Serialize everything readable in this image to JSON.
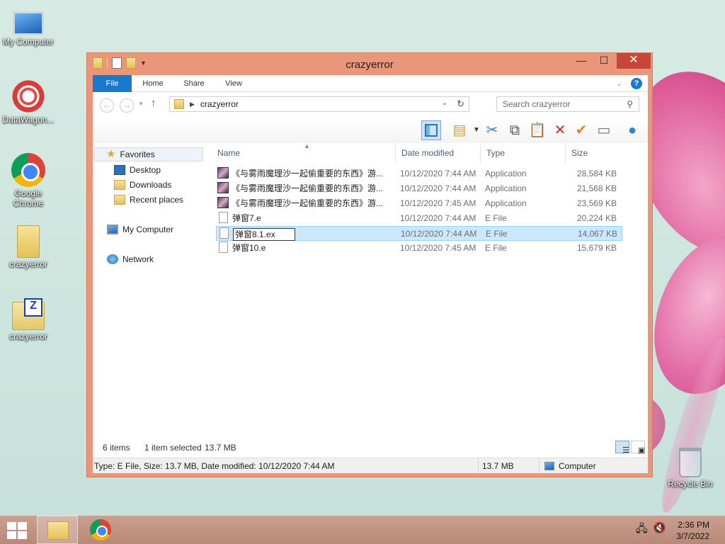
{
  "desktop": {
    "icons": [
      {
        "label": "My Computer"
      },
      {
        "label": "DataWagon..."
      },
      {
        "label": "Google Chrome"
      },
      {
        "label": "crazyerror"
      },
      {
        "label": "crazyerror"
      },
      {
        "label": "Recycle Bin"
      }
    ]
  },
  "window": {
    "title": "crazyerror",
    "controls": {
      "minimize": "—",
      "maximize": "☐",
      "close": "✕"
    },
    "ribbon_tabs": [
      "File",
      "Home",
      "Share",
      "View"
    ],
    "address": {
      "path": "crazyerror"
    },
    "search": {
      "placeholder": "Search crazyerror"
    },
    "nav": {
      "favorites": "Favorites",
      "desktop": "Desktop",
      "downloads": "Downloads",
      "recent": "Recent places",
      "computer": "My Computer",
      "network": "Network"
    },
    "columns": {
      "name": "Name",
      "date": "Date modified",
      "type": "Type",
      "size": "Size"
    },
    "files": [
      {
        "name": "《与雾雨魔理沙一起偷重要的东西》游...",
        "date": "10/12/2020 7:44 AM",
        "type": "Application",
        "size": "28,584 KB",
        "icon": "app"
      },
      {
        "name": "《与雾雨魔理沙一起偷重要的东西》游...",
        "date": "10/12/2020 7:44 AM",
        "type": "Application",
        "size": "21,568 KB",
        "icon": "app"
      },
      {
        "name": "《与雾雨魔理沙一起偷重要的东西》游...",
        "date": "10/12/2020 7:45 AM",
        "type": "Application",
        "size": "23,569 KB",
        "icon": "app"
      },
      {
        "name": "弹窗7.e",
        "date": "10/12/2020 7:44 AM",
        "type": "E File",
        "size": "20,224 KB",
        "icon": "doc"
      },
      {
        "name": "弹窗8.1.ex",
        "date": "10/12/2020 7:44 AM",
        "type": "E File",
        "size": "14,067 KB",
        "icon": "doc",
        "selected": true,
        "renaming": true
      },
      {
        "name": "弹窗10.e",
        "date": "10/12/2020 7:45 AM",
        "type": "E File",
        "size": "15,679 KB",
        "icon": "doc"
      }
    ],
    "status": {
      "count": "6 items",
      "selected": "1 item selected",
      "selected_size": "13.7 MB"
    },
    "details": {
      "info": "Type: E File, Size: 13.7 MB, Date modified: 10/12/2020 7:44 AM",
      "size": "13.7 MB",
      "location": "Computer"
    }
  },
  "taskbar": {
    "clock_time": "2:36 PM",
    "clock_date": "3/7/2022"
  }
}
